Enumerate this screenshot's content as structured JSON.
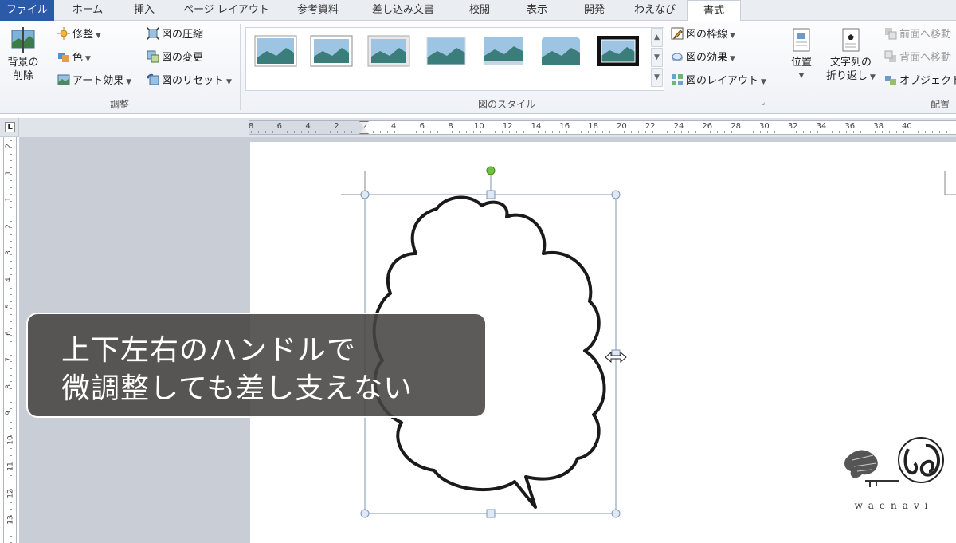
{
  "tabs": [
    {
      "label": "ファイル",
      "kind": "file"
    },
    {
      "label": "ホーム"
    },
    {
      "label": "挿入"
    },
    {
      "label": "ページ レイアウト"
    },
    {
      "label": "参考資料"
    },
    {
      "label": "差し込み文書"
    },
    {
      "label": "校閲"
    },
    {
      "label": "表示"
    },
    {
      "label": "開発"
    },
    {
      "label": "わえなび"
    },
    {
      "label": "書式",
      "kind": "active"
    }
  ],
  "ribbon": {
    "adjust": {
      "remove_bg_line1": "背景の",
      "remove_bg_line2": "削除",
      "corrections": "修整",
      "color": "色",
      "art_effects": "アート効果",
      "compress": "図の圧縮",
      "change": "図の変更",
      "reset": "図のリセット",
      "group_label": "調整"
    },
    "styles": {
      "group_label": "図のスタイル",
      "border": "図の枠線",
      "effects": "図の効果",
      "layout": "図のレイアウト"
    },
    "arrange": {
      "position": "位置",
      "wrap_line1": "文字列の",
      "wrap_line2": "折り返し",
      "bring_forward": "前面へ移動",
      "send_backward": "背面へ移動",
      "selection_pane": "オブジェクトの",
      "group_label": "配置"
    }
  },
  "ruler": {
    "h_numbers": [
      "8",
      "6",
      "4",
      "2",
      "2",
      "4",
      "6",
      "8",
      "10",
      "12",
      "14",
      "16",
      "18",
      "20",
      "22",
      "24",
      "26",
      "28",
      "30",
      "32",
      "34",
      "36",
      "38",
      "40"
    ],
    "v_numbers": [
      "2",
      "1",
      "1",
      "2",
      "3",
      "4",
      "5",
      "6",
      "7",
      "8",
      "9",
      "10",
      "11",
      "12",
      "13"
    ],
    "corner": "L"
  },
  "caption": {
    "line1": "上下左右のハンドルで",
    "line2": "微調整しても差し支えない"
  },
  "logo": {
    "text": "waenavi"
  },
  "colors": {
    "file_tab": "#2a5aa8",
    "rotate_handle": "#6fc13f",
    "caption_bg": "#474442"
  }
}
